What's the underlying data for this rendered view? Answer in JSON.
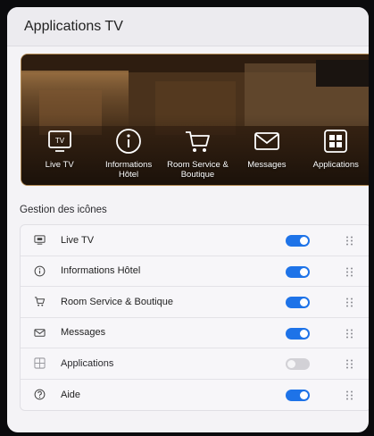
{
  "window": {
    "title": "Applications TV"
  },
  "hero": {
    "items": [
      {
        "label": "Live TV",
        "icon": "tv-icon"
      },
      {
        "label": "Informations Hôtel",
        "icon": "info-icon"
      },
      {
        "label": "Room Service & Boutique",
        "icon": "cart-icon"
      },
      {
        "label": "Messages",
        "icon": "envelope-icon"
      },
      {
        "label": "Applications",
        "icon": "grid-icon"
      }
    ]
  },
  "icons_section": {
    "title": "Gestion des icônes",
    "rows": [
      {
        "label": "Live TV",
        "icon": "tv-icon",
        "enabled": true
      },
      {
        "label": "Informations Hôtel",
        "icon": "info-icon",
        "enabled": true
      },
      {
        "label": "Room Service & Boutique",
        "icon": "cart-icon",
        "enabled": true
      },
      {
        "label": "Messages",
        "icon": "envelope-icon",
        "enabled": true
      },
      {
        "label": "Applications",
        "icon": "grid-icon",
        "enabled": false
      },
      {
        "label": "Aide",
        "icon": "help-icon",
        "enabled": true
      }
    ]
  },
  "colors": {
    "accent": "#1e73e8",
    "toggle_off": "#d2d1d6",
    "hero_border": "#b28a54"
  }
}
